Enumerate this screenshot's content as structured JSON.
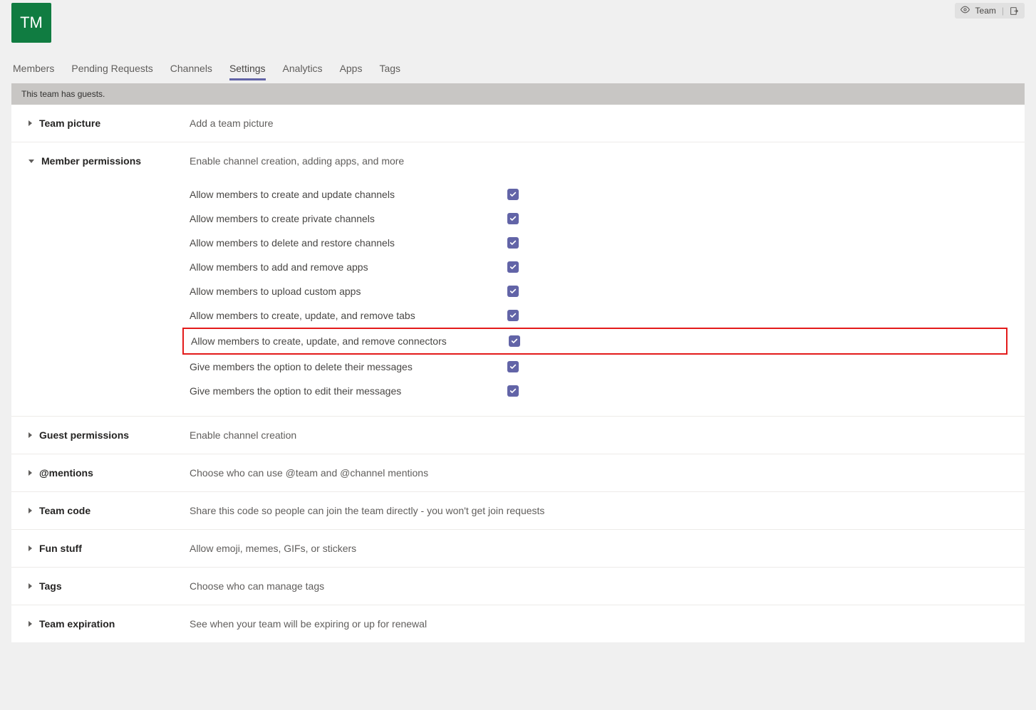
{
  "team": {
    "avatar_initials": "TM",
    "header_button_label": "Team"
  },
  "tabs": {
    "members": "Members",
    "pending": "Pending Requests",
    "channels": "Channels",
    "settings": "Settings",
    "analytics": "Analytics",
    "apps": "Apps",
    "tags": "Tags"
  },
  "banner": "This team has guests.",
  "sections": {
    "team_picture": {
      "title": "Team picture",
      "desc": "Add a team picture"
    },
    "member_permissions": {
      "title": "Member permissions",
      "desc": "Enable channel creation, adding apps, and more",
      "items": [
        {
          "label": "Allow members to create and update channels",
          "checked": true,
          "highlight": false
        },
        {
          "label": "Allow members to create private channels",
          "checked": true,
          "highlight": false
        },
        {
          "label": "Allow members to delete and restore channels",
          "checked": true,
          "highlight": false
        },
        {
          "label": "Allow members to add and remove apps",
          "checked": true,
          "highlight": false
        },
        {
          "label": "Allow members to upload custom apps",
          "checked": true,
          "highlight": false
        },
        {
          "label": "Allow members to create, update, and remove tabs",
          "checked": true,
          "highlight": false
        },
        {
          "label": "Allow members to create, update, and remove connectors",
          "checked": true,
          "highlight": true
        },
        {
          "label": "Give members the option to delete their messages",
          "checked": true,
          "highlight": false
        },
        {
          "label": "Give members the option to edit their messages",
          "checked": true,
          "highlight": false
        }
      ]
    },
    "guest_permissions": {
      "title": "Guest permissions",
      "desc": "Enable channel creation"
    },
    "mentions": {
      "title": "@mentions",
      "desc": "Choose who can use @team and @channel mentions"
    },
    "team_code": {
      "title": "Team code",
      "desc": "Share this code so people can join the team directly - you won't get join requests"
    },
    "fun_stuff": {
      "title": "Fun stuff",
      "desc": "Allow emoji, memes, GIFs, or stickers"
    },
    "tags_section": {
      "title": "Tags",
      "desc": "Choose who can manage tags"
    },
    "team_expiration": {
      "title": "Team expiration",
      "desc": "See when your team will be expiring or up for renewal"
    }
  }
}
